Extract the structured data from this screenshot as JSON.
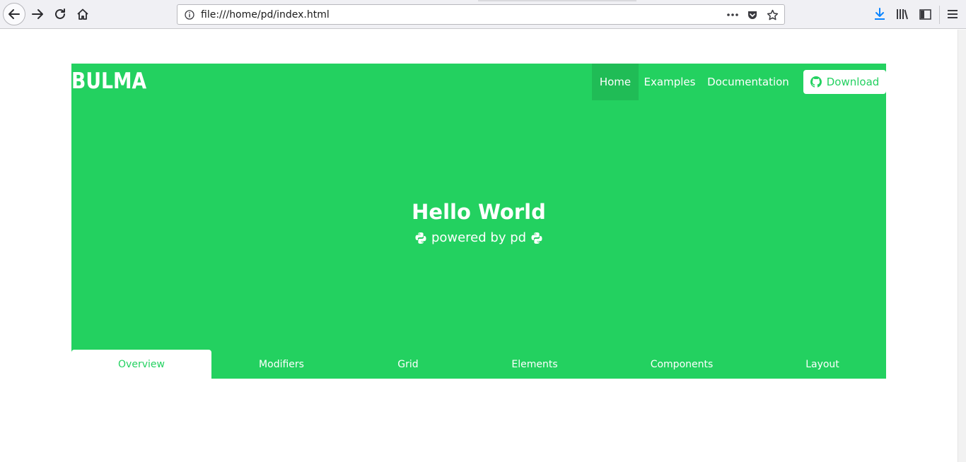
{
  "browser": {
    "url": "file:///home/pd/index.html",
    "icons": [
      "back-icon",
      "forward-icon",
      "reload-icon",
      "home-icon",
      "info-icon",
      "more-icon",
      "pocket-icon",
      "star-icon",
      "download-arrow-icon",
      "library-icon",
      "sidebar-icon",
      "menu-icon"
    ],
    "accent_download": "#0a84ff"
  },
  "navbar": {
    "brand": "BULMA",
    "items": [
      {
        "label": "Home",
        "active": true
      },
      {
        "label": "Examples",
        "active": false
      },
      {
        "label": "Documentation",
        "active": false
      }
    ],
    "download_label": "Download",
    "download_icon": "github-icon"
  },
  "hero": {
    "title": "Hello World",
    "subtitle": "powered by pd",
    "subtitle_icon": "python-icon",
    "color": "#23d160"
  },
  "tabs": [
    {
      "label": "Overview",
      "active": true
    },
    {
      "label": "Modifiers",
      "active": false
    },
    {
      "label": "Grid",
      "active": false
    },
    {
      "label": "Elements",
      "active": false
    },
    {
      "label": "Components",
      "active": false
    },
    {
      "label": "Layout",
      "active": false
    }
  ]
}
